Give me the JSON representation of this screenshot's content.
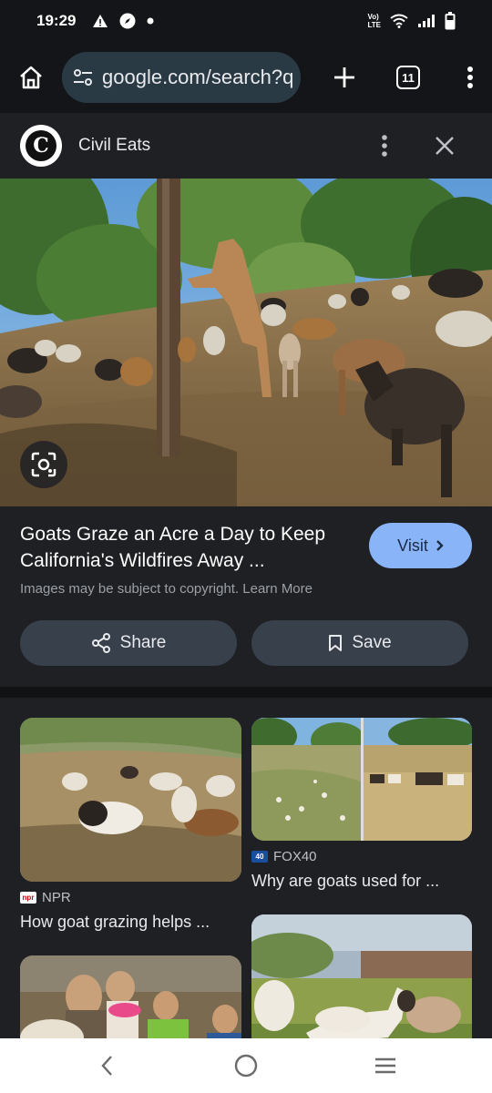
{
  "status": {
    "time": "19:29",
    "network": "Vo)\nLTE"
  },
  "browser": {
    "url": "google.com/search?q",
    "tab_count": "11"
  },
  "preview": {
    "site_name": "Civil Eats",
    "site_logo_letter": "C",
    "title": "Goats Graze an Acre a Day to Keep California's Wildfires Away ...",
    "visit_label": "Visit",
    "copyright": "Images may be subject to copyright. Learn More",
    "share_label": "Share",
    "save_label": "Save"
  },
  "results": [
    {
      "source": "NPR",
      "caption": "How goat grazing helps ..."
    },
    {
      "source": "FOX40",
      "caption": "Why are goats used for ..."
    }
  ],
  "colors": {
    "accent": "#8ab4f8",
    "background": "#1f2024",
    "button": "#38404c"
  },
  "icons": [
    "home-icon",
    "site-settings-icon",
    "plus-icon",
    "tabs-icon",
    "more-vert-icon",
    "close-icon",
    "lens-icon",
    "chevron-right-icon",
    "share-icon",
    "bookmark-icon",
    "back-icon",
    "home-nav-icon",
    "recents-icon"
  ]
}
